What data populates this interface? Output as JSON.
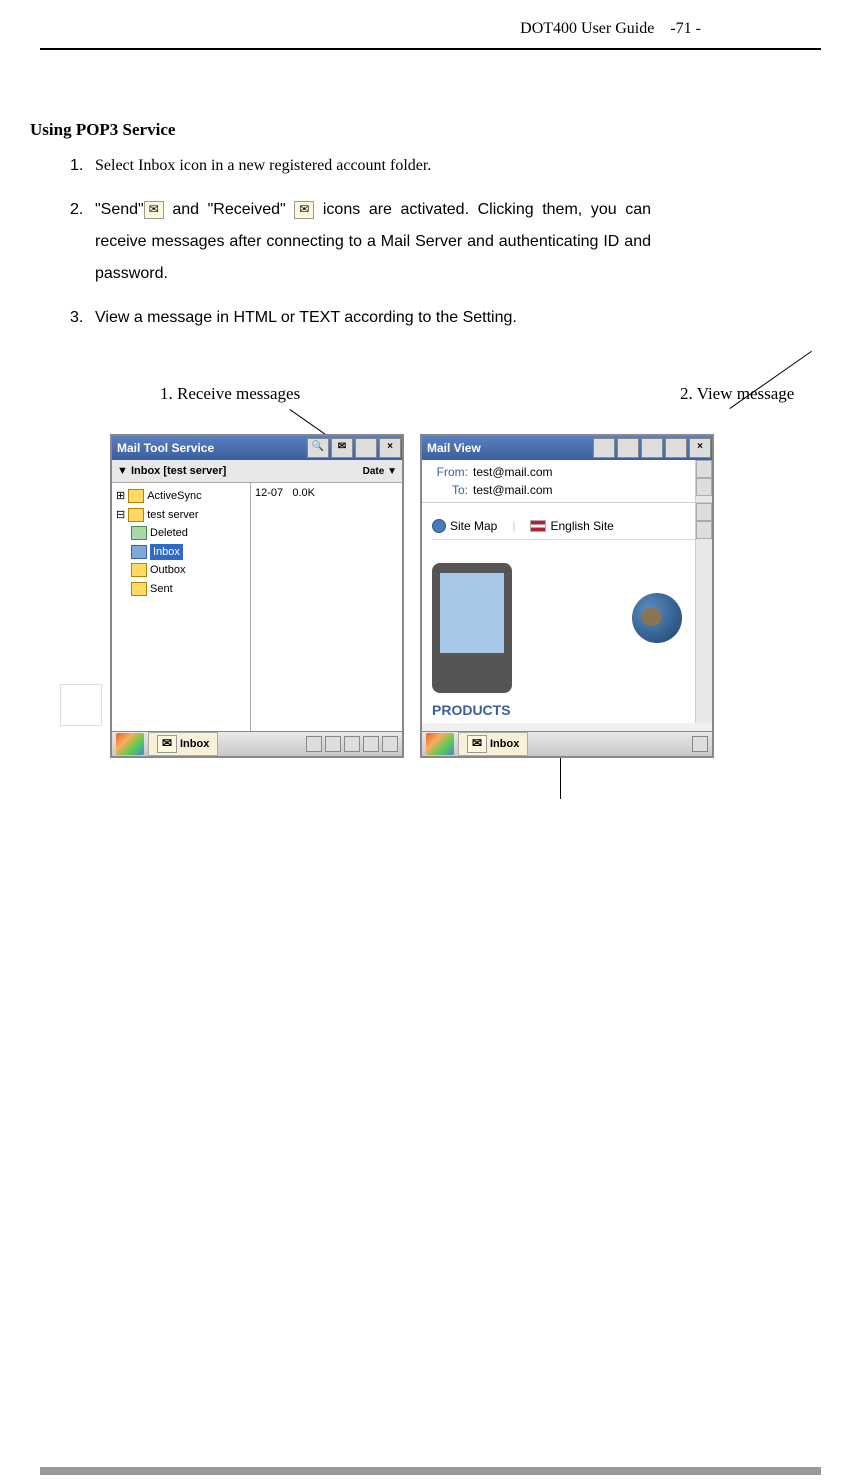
{
  "header": {
    "title": "DOT400 User Guide",
    "page": "-71 -"
  },
  "section": {
    "title": "Using POP3 Service",
    "items": [
      {
        "num": "1.",
        "text": "Select Inbox icon in a new registered account folder."
      },
      {
        "num": "2.",
        "text_parts": [
          "\"Send\"",
          " and \"Received\" ",
          " icons are activated. Clicking them, you can receive messages after connecting to a Mail Server and authenticating ID and password."
        ]
      },
      {
        "num": "3.",
        "text": "View a message in HTML or TEXT according to the Setting."
      }
    ]
  },
  "labels": {
    "receive": "1. Receive messages",
    "view": "2. View message"
  },
  "screenshot1": {
    "title": "Mail  Tool  Service",
    "subbar_prefix": "▼",
    "subbar": "Inbox [test server]",
    "subbar_right": "Date",
    "close": "×",
    "bell": "🔍",
    "env": "✉",
    "tree": {
      "activesync": "ActiveSync",
      "testserver": "test server",
      "deleted": "Deleted",
      "inbox": "Inbox",
      "outbox": "Outbox",
      "sent": "Sent"
    },
    "list": {
      "date": "12-07",
      "size": "0.0K"
    },
    "taskbar": "Inbox"
  },
  "screenshot2": {
    "title": "Mail  View",
    "close": "×",
    "from_lbl": "From:",
    "from_val": "test@mail.com",
    "to_lbl": "To:",
    "to_val": "test@mail.com",
    "sitemap": "Site Map",
    "english": "English Site",
    "products": "PRODUCTS",
    "taskbar": "Inbox"
  }
}
